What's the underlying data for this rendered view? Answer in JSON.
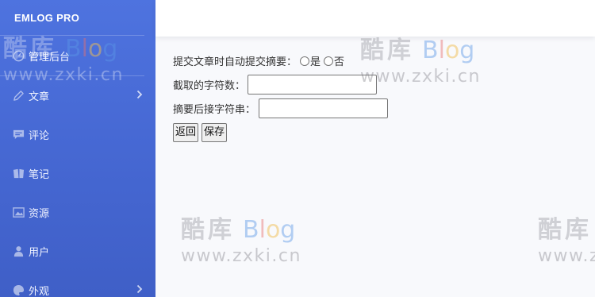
{
  "brand": "EMLOG PRO",
  "sidebar": {
    "items": [
      {
        "label": "管理后台",
        "icon": "dashboard-icon"
      },
      {
        "label": "文章",
        "icon": "pencil-icon",
        "has_submenu": true
      },
      {
        "label": "评论",
        "icon": "comment-icon"
      },
      {
        "label": "笔记",
        "icon": "note-icon"
      },
      {
        "label": "资源",
        "icon": "image-icon"
      },
      {
        "label": "用户",
        "icon": "user-icon"
      },
      {
        "label": "外观",
        "icon": "palette-icon",
        "has_submenu": true
      }
    ]
  },
  "form": {
    "auto_excerpt_label": "提交文章时自动提交摘要：",
    "option_yes": "是",
    "option_no": "否",
    "excerpt_length_label": "截取的字符数：",
    "excerpt_length_value": "",
    "suffix_label": "摘要后接字符串：",
    "suffix_value": "",
    "back_button": "返回",
    "save_button": "保存"
  },
  "watermark": {
    "name": "酷库",
    "blog": "Blog",
    "url": "www.zxki.cn"
  },
  "colors": {
    "sidebar_top": "#4e73df",
    "sidebar_bottom": "#3f5fc7",
    "content_bg": "#f8f9fc",
    "topbar_bg": "#ffffff"
  }
}
